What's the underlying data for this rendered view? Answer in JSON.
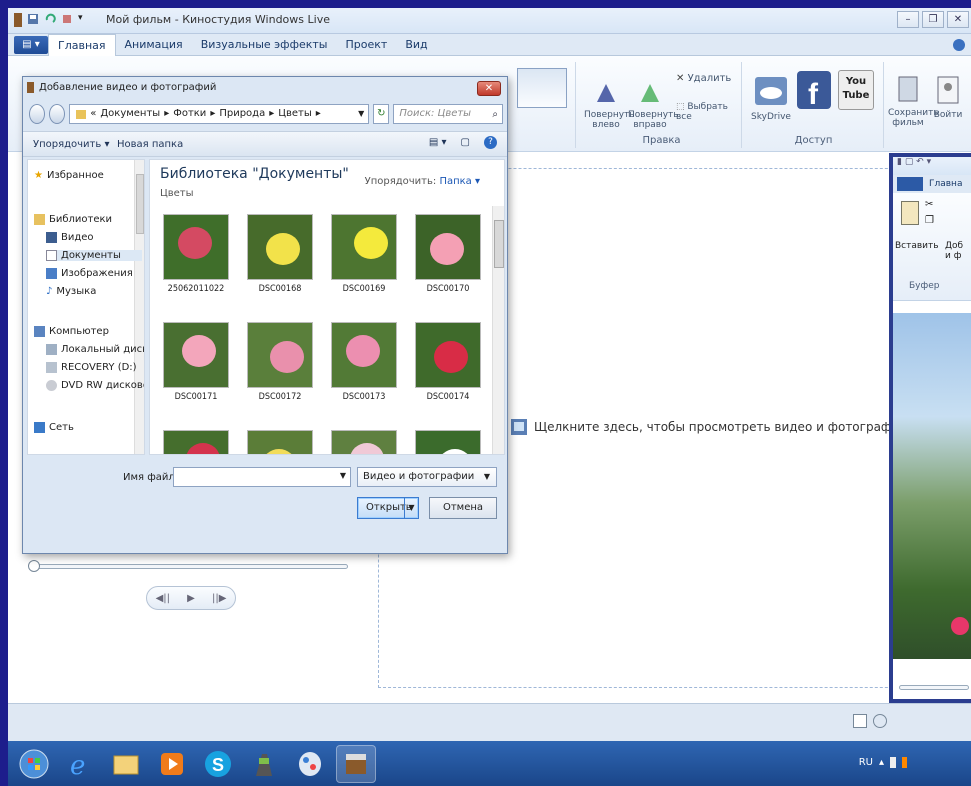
{
  "app": {
    "title": "Мой фильм - Киностудия Windows Live",
    "window_buttons": [
      "–",
      "❐",
      "✕"
    ]
  },
  "ribbon_tabs": [
    "Главная",
    "Анимация",
    "Визуальные эффекты",
    "Проект",
    "Вид"
  ],
  "ribbon": {
    "rotate_left": "Повернуть влево",
    "rotate_right": "Повернуть вправо",
    "delete": "Удалить",
    "select_all": "Выбрать все",
    "edit_group": "Правка",
    "skydrive": "SkyDrive",
    "youtube": "You Tube",
    "save_movie": "Сохранить фильм",
    "sign_in": "Войти",
    "share_group": "Доступ"
  },
  "storyboard": {
    "hint": "Щелкните здесь, чтобы просмотреть видео и фотографии"
  },
  "dialog": {
    "title": "Добавление видео и фотографий",
    "address": [
      "«",
      "Документы",
      "Фотки",
      "Природа",
      "Цветы"
    ],
    "search_placeholder": "Поиск: Цветы",
    "organize": "Упорядочить ▾",
    "new_folder": "Новая папка",
    "nav": {
      "favorites": "Избранное",
      "libraries": "Библиотеки",
      "video": "Видео",
      "documents": "Документы",
      "images": "Изображения",
      "music": "Музыка",
      "computer": "Компьютер",
      "local_disk": "Локальный диск",
      "recovery": "RECOVERY (D:)",
      "dvd": "DVD RW дисково",
      "network": "Сеть"
    },
    "library_title": "Библиотека \"Документы\"",
    "library_sub": "Цветы",
    "arrange_label": "Упорядочить:",
    "arrange_value": "Папка ▾",
    "files": [
      {
        "name": "25062011022",
        "bg": "#3f6e2a",
        "flower": "#d44a62"
      },
      {
        "name": "DSC00168",
        "bg": "#476b2b",
        "flower": "#f2e24a"
      },
      {
        "name": "DSC00169",
        "bg": "#4d7530",
        "flower": "#f4ea3c"
      },
      {
        "name": "DSC00170",
        "bg": "#3c6328",
        "flower": "#f4a0b4"
      },
      {
        "name": "DSC00171",
        "bg": "#496f31",
        "flower": "#f3a6bb"
      },
      {
        "name": "DSC00172",
        "bg": "#5a7f3b",
        "flower": "#e990ac"
      },
      {
        "name": "DSC00173",
        "bg": "#527a36",
        "flower": "#ec8fb0"
      },
      {
        "name": "DSC00174",
        "bg": "#3f6a2b",
        "flower": "#d82c46"
      },
      {
        "name": "",
        "bg": "#456e2d",
        "flower": "#d4334d"
      },
      {
        "name": "",
        "bg": "#5b7d38",
        "flower": "#f2dc5a"
      },
      {
        "name": "",
        "bg": "#5f8040",
        "flower": "#f0c9d6"
      },
      {
        "name": "",
        "bg": "#3b6b2c",
        "flower": "#ffffff"
      }
    ],
    "filename_label": "Имя файла:",
    "filename_value": "",
    "filetype": "Видео и фотографии",
    "open": "Открыть",
    "cancel": "Отмена"
  },
  "playback": [
    "◀||",
    "▶",
    "||▶"
  ],
  "taskbar": {
    "lang": "RU",
    "apps": [
      "start-orb",
      "internet-explorer",
      "explorer",
      "media-player",
      "skype",
      "movie-maker-clapper",
      "paint",
      "movie-maker"
    ]
  },
  "window2": {
    "tab": "Главна",
    "paste": "Вставить",
    "add_short": "Доб и ф",
    "clipboard": "Буфер"
  },
  "colors": {
    "accent": "#1c58b5",
    "desktop": "#1d1d8c",
    "taskbar": "#1f4c93"
  }
}
